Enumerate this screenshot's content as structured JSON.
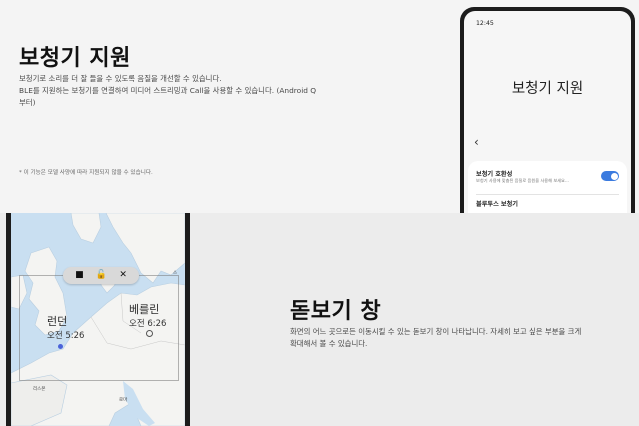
{
  "hearing": {
    "title": "보청기 지원",
    "desc_line1": "보청기로 소리를 더 잘 들을 수 있도록 음질을 개선할 수 있습니다.",
    "desc_line2": "BLE를 지원하는 보청기를 연결하여 미디어 스트리밍과 Call을 사용할 수 있습니다. (Android Q",
    "desc_line3": "부터)",
    "footnote": "* 이 기능은 모델 사양에 따라 지원되지 않을 수 있습니다."
  },
  "phone": {
    "status_time": "12:45",
    "page_title": "보청기 지원",
    "setting1_title": "보청기 호환성",
    "setting1_sub": "보청기 사용에 맞춤된 음질로 음원을 사용해 보세요...",
    "setting1_enabled": true,
    "setting2_title": "블루투스 보청기"
  },
  "magnifier": {
    "title": "돋보기 창",
    "desc_line1": "화면의 어느 곳으로든 이동시킬 수 있는 돋보기 창이 나타납니다. 자세히 보고 싶은 부분을 크게",
    "desc_line2": "확대해서 볼 수 있습니다."
  },
  "map": {
    "city1_name": "런던",
    "city1_time": "오전 5:26",
    "city2_name": "베를린",
    "city2_time": "오전 6:26",
    "minor_label_1": "스",
    "minor_label_2": "리스본",
    "minor_label_3": "로마"
  },
  "colors": {
    "accent": "#3b7bdf",
    "sea": "#c9dff1",
    "land": "#f4f4f2"
  }
}
